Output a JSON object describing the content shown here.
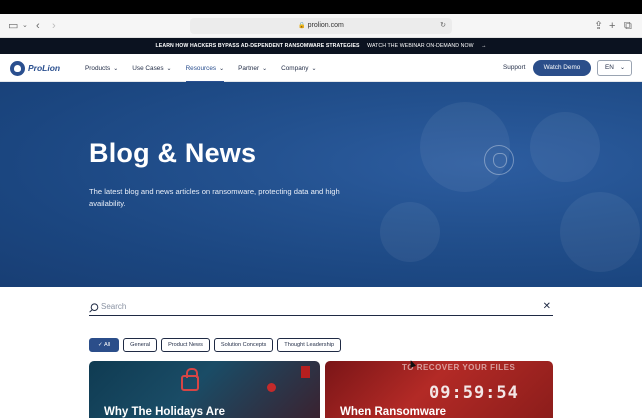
{
  "browser": {
    "url": "prolion.com"
  },
  "banner": {
    "headline": "LEARN HOW HACKERS BYPASS AD-DEPENDENT RANSOMWARE STRATEGIES",
    "cta": "WATCH THE WEBINAR ON-DEMAND NOW",
    "arrow": "→"
  },
  "nav": {
    "logo_text": "ProLion",
    "items": [
      {
        "label": "Products"
      },
      {
        "label": "Use Cases"
      },
      {
        "label": "Resources"
      },
      {
        "label": "Partner"
      },
      {
        "label": "Company"
      }
    ],
    "support": "Support",
    "watch_demo": "Watch Demo",
    "language": "EN"
  },
  "hero": {
    "title": "Blog & News",
    "subtitle": "The latest blog and news articles on ransomware, protecting data and high availability."
  },
  "search": {
    "placeholder": "Search"
  },
  "filters": [
    {
      "label": "All",
      "selected": true
    },
    {
      "label": "General",
      "selected": false
    },
    {
      "label": "Product News",
      "selected": false
    },
    {
      "label": "Solution Concepts",
      "selected": false
    },
    {
      "label": "Thought Leadership",
      "selected": false
    }
  ],
  "cards": [
    {
      "title": "Why The Holidays Are"
    },
    {
      "title": "When Ransomware",
      "image_text_top": "TO RECOVER YOUR FILES",
      "image_timer": "09:59:54"
    }
  ],
  "colors": {
    "brand": "#2a4f8f",
    "hero_bg": "#1f4d8c",
    "banner_bg": "#0b1220"
  }
}
